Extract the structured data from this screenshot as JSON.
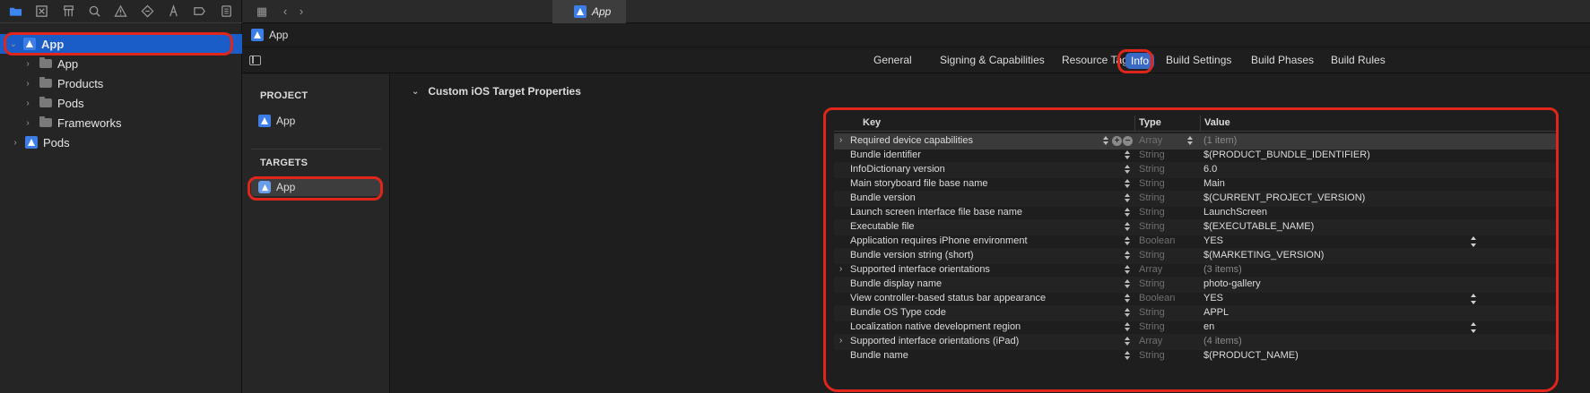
{
  "navigator": {
    "toolbar_icons": [
      "folder-icon",
      "source-control-icon",
      "hierarchy-icon",
      "search-icon",
      "warning-icon",
      "tests-icon",
      "debug-icon",
      "breakpoint-icon",
      "report-icon"
    ],
    "tree": [
      {
        "label": "App",
        "kind": "project",
        "expanded": true,
        "selected": true
      },
      {
        "label": "App",
        "kind": "folder"
      },
      {
        "label": "Products",
        "kind": "folder"
      },
      {
        "label": "Pods",
        "kind": "folder"
      },
      {
        "label": "Frameworks",
        "kind": "folder"
      },
      {
        "label": "Pods",
        "kind": "project"
      }
    ]
  },
  "tabbar": {
    "active_tab": "App"
  },
  "breadcrumb": {
    "label": "App"
  },
  "editor_tabs": {
    "general": "General",
    "signing": "Signing & Capabilities",
    "resource_tags": "Resource Tags",
    "info": "Info",
    "build_settings": "Build Settings",
    "build_phases": "Build Phases",
    "build_rules": "Build Rules"
  },
  "targets_panel": {
    "project_heading": "PROJECT",
    "project_item": "App",
    "targets_heading": "TARGETS",
    "target_item": "App"
  },
  "section": {
    "title": "Custom iOS Target Properties"
  },
  "plist": {
    "headers": {
      "key": "Key",
      "type": "Type",
      "value": "Value"
    },
    "rows": [
      {
        "key": "Required device capabilities",
        "type": "Array",
        "value": "(1 item)"
      },
      {
        "key": "Bundle identifier",
        "type": "String",
        "value": "$(PRODUCT_BUNDLE_IDENTIFIER)"
      },
      {
        "key": "InfoDictionary version",
        "type": "String",
        "value": "6.0"
      },
      {
        "key": "Main storyboard file base name",
        "type": "String",
        "value": "Main"
      },
      {
        "key": "Bundle version",
        "type": "String",
        "value": "$(CURRENT_PROJECT_VERSION)"
      },
      {
        "key": "Launch screen interface file base name",
        "type": "String",
        "value": "LaunchScreen"
      },
      {
        "key": "Executable file",
        "type": "String",
        "value": "$(EXECUTABLE_NAME)"
      },
      {
        "key": "Application requires iPhone environment",
        "type": "Boolean",
        "value": "YES"
      },
      {
        "key": "Bundle version string (short)",
        "type": "String",
        "value": "$(MARKETING_VERSION)"
      },
      {
        "key": "Supported interface orientations",
        "type": "Array",
        "value": "(3 items)"
      },
      {
        "key": "Bundle display name",
        "type": "String",
        "value": "photo-gallery"
      },
      {
        "key": "View controller-based status bar appearance",
        "type": "Boolean",
        "value": "YES"
      },
      {
        "key": "Bundle OS Type code",
        "type": "String",
        "value": "APPL"
      },
      {
        "key": "Localization native development region",
        "type": "String",
        "value": "en"
      },
      {
        "key": "Supported interface orientations (iPad)",
        "type": "Array",
        "value": "(4 items)"
      },
      {
        "key": "Bundle name",
        "type": "String",
        "value": "$(PRODUCT_NAME)"
      }
    ]
  },
  "colors": {
    "selection_blue": "#1a5cc8",
    "annotation_red": "#e0261a"
  }
}
